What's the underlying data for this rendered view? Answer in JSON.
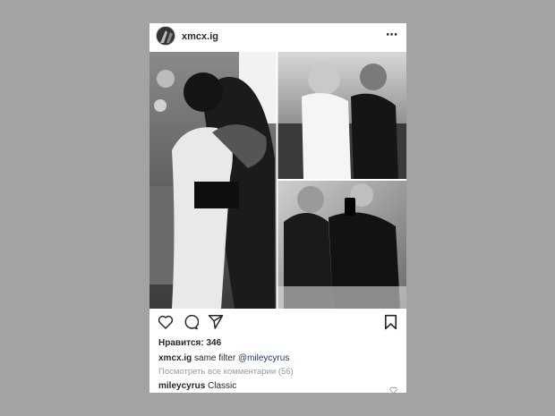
{
  "post": {
    "username": "xmcx.ig",
    "more_icon": "⋯",
    "likes_label": "Нравится: 346",
    "caption": {
      "username": "xmcx.ig",
      "text": "same filter",
      "mention": "@mileycyrus"
    },
    "view_all_comments": "Посмотреть все комментарии (56)",
    "comment": {
      "username": "mileycyrus",
      "text": "Classic"
    }
  },
  "icons": {
    "like": "heart-icon",
    "comment": "comment-icon",
    "share": "send-icon",
    "save": "bookmark-icon",
    "comment_like": "heart-icon"
  },
  "colors": {
    "background": "#a3a3a3",
    "card": "#ffffff",
    "text": "#262626",
    "muted": "#9a9a9a",
    "mention": "#1e3a6e"
  }
}
